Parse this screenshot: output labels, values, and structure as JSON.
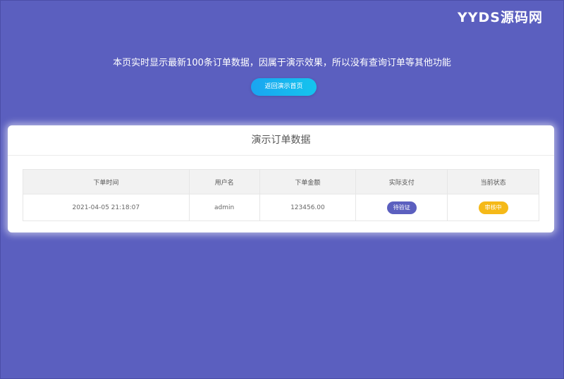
{
  "watermark": "YYDS源码网",
  "notice": "本页实时显示最新100条订单数据，因属于演示效果，所以没有查询订单等其他功能",
  "back_button": "返回演示首页",
  "card": {
    "title": "演示订单数据"
  },
  "table": {
    "headers": [
      "下单时间",
      "用户名",
      "下单金额",
      "实际支付",
      "当前状态"
    ],
    "rows": [
      {
        "time": "2021-04-05 21:18:07",
        "username": "admin",
        "amount": "123456.00",
        "payment": "待验证",
        "status": "审核中"
      }
    ]
  },
  "colors": {
    "background": "#5b5fbf",
    "button_gradient_start": "#1aa5f0",
    "button_gradient_end": "#14c4ee",
    "badge_payment": "#5b5fbf",
    "badge_status": "#f5b918"
  }
}
